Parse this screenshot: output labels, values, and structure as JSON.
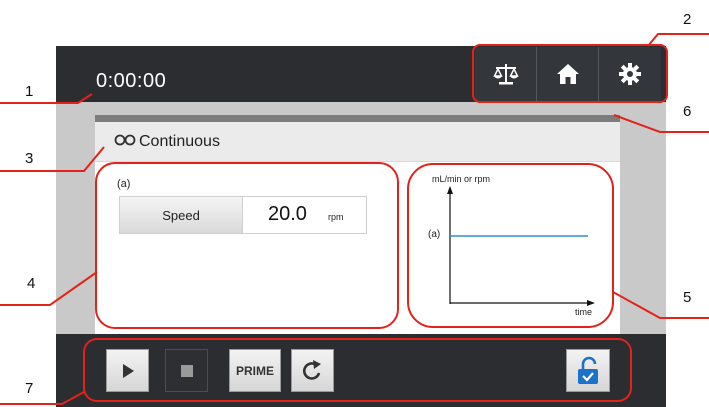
{
  "header": {
    "timer": "0:00:00",
    "buttons": [
      {
        "name": "balance-icon"
      },
      {
        "name": "home-icon"
      },
      {
        "name": "gear-icon"
      }
    ]
  },
  "mode": {
    "icon": "infinity-icon",
    "label": "Continuous"
  },
  "speed": {
    "tag": "(a)",
    "label": "Speed",
    "value": "20.0",
    "unit": "rpm"
  },
  "graph": {
    "ylabel": "mL/min or rpm",
    "xlabel": "time",
    "marker": "(a)",
    "line_color": "#2b8fd6"
  },
  "controls": {
    "prime_label": "PRIME",
    "icons": [
      "play-icon",
      "stop-icon",
      "rotate-icon",
      "unlock-icon"
    ]
  },
  "annotations": {
    "callouts": [
      "1",
      "2",
      "3",
      "4",
      "5",
      "6",
      "7"
    ],
    "color": "#e2231a"
  }
}
